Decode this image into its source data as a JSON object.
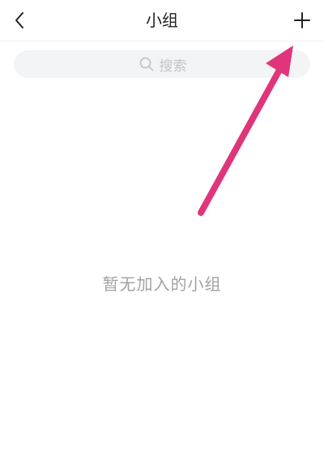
{
  "header": {
    "title": "小组",
    "back_icon": "chevron-left-icon",
    "add_icon": "plus-icon"
  },
  "search": {
    "placeholder": "搜索",
    "icon": "search-icon"
  },
  "empty_state": {
    "text": "暂无加入的小组"
  },
  "annotation": {
    "arrow_color": "#e0357a"
  }
}
